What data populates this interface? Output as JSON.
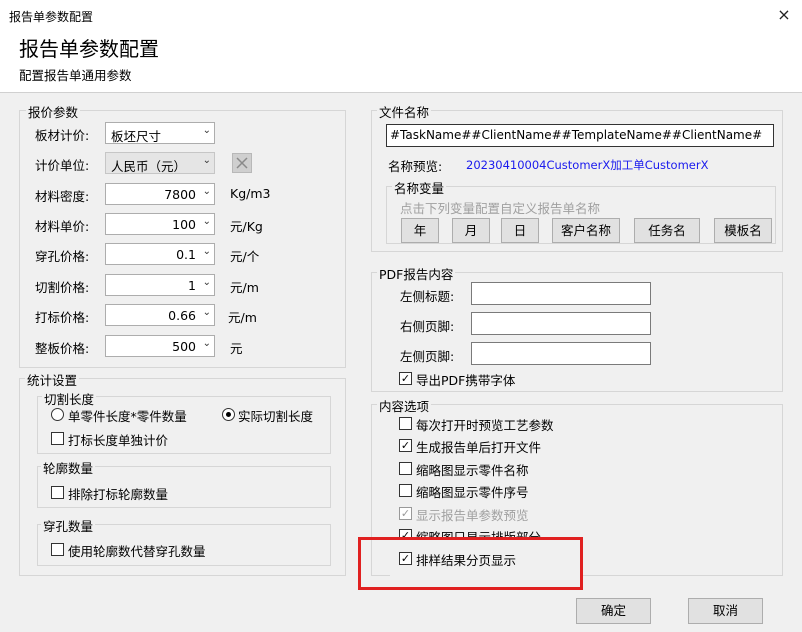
{
  "window": {
    "title": "报告单参数配置",
    "close": "×"
  },
  "header": {
    "title": "报告单参数配置",
    "subtitle": "配置报告单通用参数"
  },
  "quote": {
    "title": "报价参数",
    "board_label": "板材计价:",
    "board_value": "板坯尺寸",
    "unit_label": "计价单位:",
    "unit_value": "人民币（元）",
    "rows": [
      {
        "label": "材料密度:",
        "value": "7800",
        "unit": "Kg/m3"
      },
      {
        "label": "材料单价:",
        "value": "100",
        "unit": "元/Kg"
      },
      {
        "label": "穿孔价格:",
        "value": "0.1",
        "unit": "元/个"
      },
      {
        "label": "切割价格:",
        "value": "1",
        "unit": "元/m"
      },
      {
        "label": "打标价格:",
        "value": "0.66",
        "unit": "元/m"
      },
      {
        "label": "整板价格:",
        "value": "500",
        "unit": "元"
      }
    ]
  },
  "stats": {
    "title": "统计设置",
    "cut": {
      "title": "切割长度",
      "opt1": "单零件长度*零件数量",
      "opt2": "实际切割长度",
      "mark_separate": "打标长度单独计价"
    },
    "contour": {
      "title": "轮廓数量",
      "exclude": "排除打标轮廓数量"
    },
    "pierce": {
      "title": "穿孔数量",
      "use_contour": "使用轮廓数代替穿孔数量"
    }
  },
  "file": {
    "title": "文件名称",
    "name_value": "#TaskName##ClientName##TemplateName##ClientName#",
    "preview_label": "名称预览:",
    "preview_value": "20230410004CustomerX加工单CustomerX",
    "vars_title": "名称变量",
    "vars_hint": "点击下列变量配置自定义报告单名称",
    "buttons": [
      "年",
      "月",
      "日",
      "客户名称",
      "任务名",
      "模板名"
    ]
  },
  "pdf": {
    "title": "PDF报告内容",
    "left_title": "左侧标题:",
    "right_footer": "右侧页脚:",
    "left_footer": "左侧页脚:",
    "embed_font": "导出PDF携带字体"
  },
  "content": {
    "title": "内容选项",
    "options": [
      {
        "label": "每次打开时预览工艺参数",
        "checked": false,
        "disabled": false
      },
      {
        "label": "生成报告单后打开文件",
        "checked": true,
        "disabled": false
      },
      {
        "label": "缩略图显示零件名称",
        "checked": false,
        "disabled": false
      },
      {
        "label": "缩略图显示零件序号",
        "checked": false,
        "disabled": false
      },
      {
        "label": "显示报告单参数预览",
        "checked": true,
        "disabled": true
      },
      {
        "label": "缩略图只显示排版部分",
        "checked": true,
        "disabled": false
      },
      {
        "label": "排样结果分页显示",
        "checked": true,
        "disabled": false
      }
    ]
  },
  "footer": {
    "ok": "确定",
    "cancel": "取消"
  }
}
